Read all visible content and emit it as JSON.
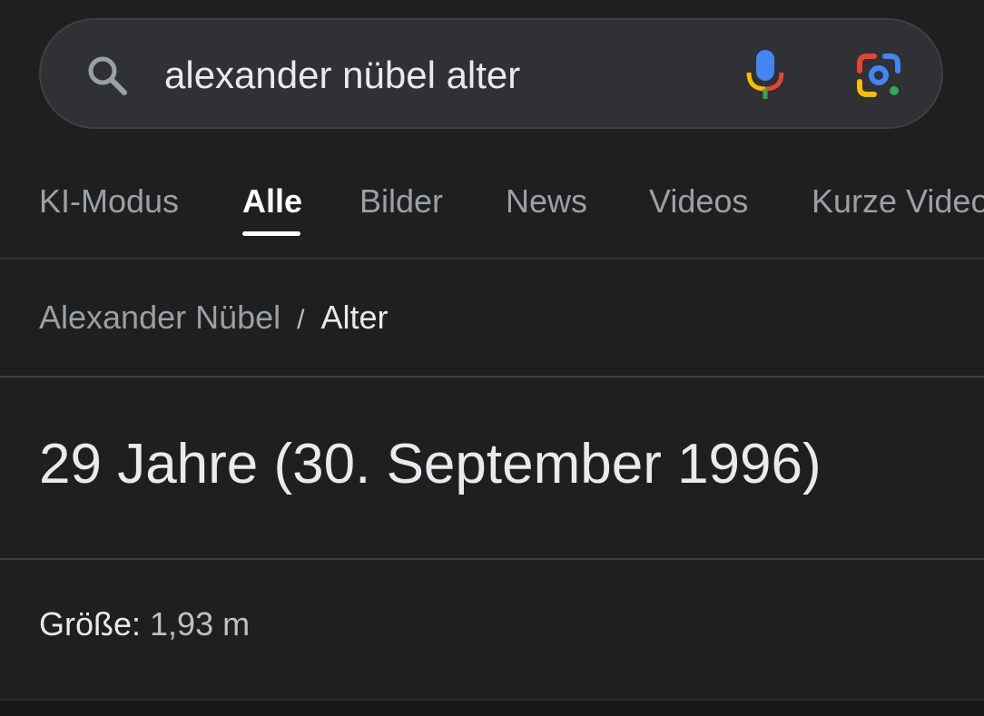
{
  "search": {
    "query": "alexander nübel alter",
    "icons": {
      "search": "search-icon",
      "voice": "microphone-icon",
      "lens": "google-lens-icon"
    }
  },
  "tabs": [
    {
      "label": "KI-Modus",
      "active": false
    },
    {
      "label": "Alle",
      "active": true
    },
    {
      "label": "Bilder",
      "active": false
    },
    {
      "label": "News",
      "active": false
    },
    {
      "label": "Videos",
      "active": false
    },
    {
      "label": "Kurze Videos",
      "active": false
    }
  ],
  "breadcrumb": {
    "parent": "Alexander Nübel",
    "separator": "/",
    "current": "Alter"
  },
  "answer": {
    "text": "29 Jahre (30. September 1996)"
  },
  "details": {
    "height_label": "Größe:",
    "height_value": "1,93 m"
  },
  "colors": {
    "background": "#1f1f1f",
    "search_bg": "#303134",
    "text_primary": "#e8eaed",
    "text_secondary": "#9aa0a6",
    "google_blue": "#4285f4",
    "google_red": "#ea4335",
    "google_yellow": "#fbbc04",
    "google_green": "#34a853"
  }
}
